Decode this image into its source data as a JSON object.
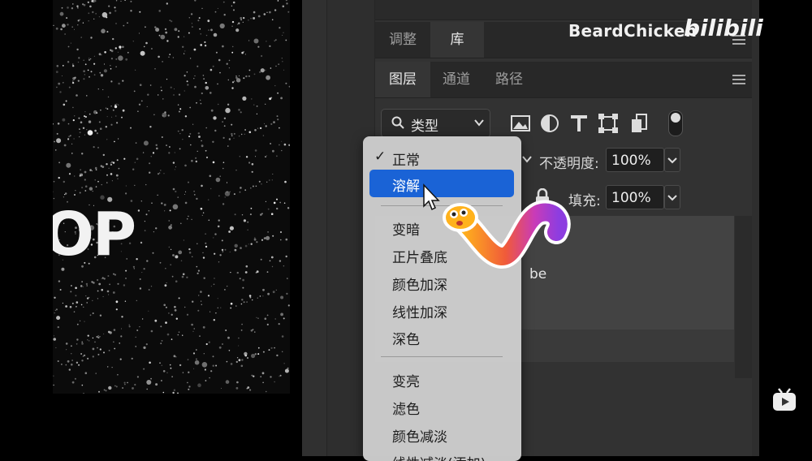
{
  "canvas": {
    "visible_text": "OP"
  },
  "panel_tabs_top": [
    {
      "label": "调整"
    },
    {
      "label": "库"
    }
  ],
  "panel_tabs_main": [
    {
      "label": "图层"
    },
    {
      "label": "通道"
    },
    {
      "label": "路径"
    }
  ],
  "filter": {
    "label": "类型"
  },
  "filter_icons": [
    "image-filter-icon",
    "adjustment-filter-icon",
    "type-filter-icon",
    "shape-filter-icon",
    "smart-object-filter-icon"
  ],
  "opacity": {
    "label": "不透明度:",
    "value": "100%"
  },
  "fill": {
    "label": "填充:",
    "value": "100%"
  },
  "layer": {
    "name_fragment": "be"
  },
  "blend_menu": {
    "checked": "正常",
    "selected": "溶解",
    "groups": [
      [
        "变暗",
        "正片叠底",
        "颜色加深",
        "线性加深",
        "深色"
      ],
      [
        "变亮",
        "滤色",
        "颜色减淡",
        "线性减淡(添加)"
      ]
    ]
  },
  "watermark": {
    "author": "BeardChicken",
    "site": "bilibili"
  },
  "colors": {
    "highlight": "#1a63d6",
    "panel": "#323232",
    "menu": "#cdcdcd"
  }
}
